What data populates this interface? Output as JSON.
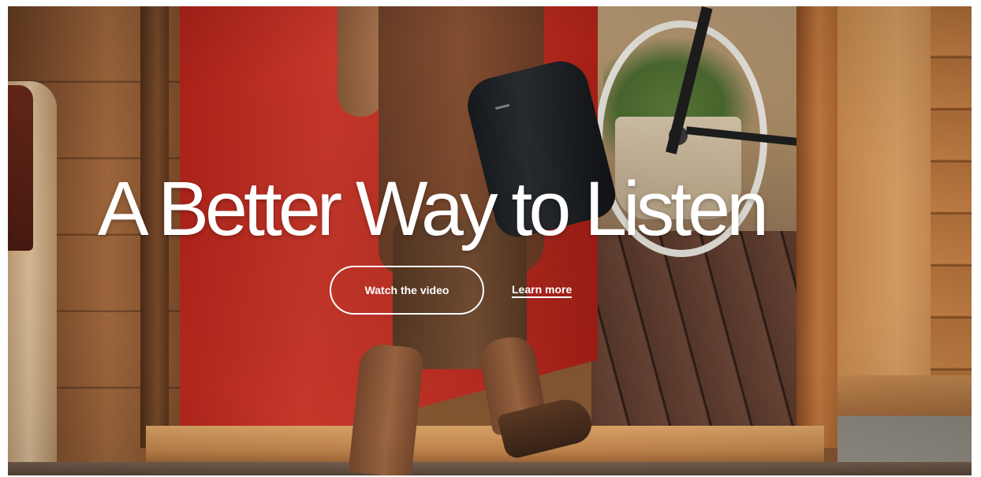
{
  "hero": {
    "title": "A Better Way to Listen",
    "primary_cta_label": "Watch the video",
    "secondary_cta_label": "Learn more"
  },
  "background": {
    "subject": "hero-photo-background",
    "accent_color": "#c22f23",
    "text_color": "#ffffff"
  }
}
